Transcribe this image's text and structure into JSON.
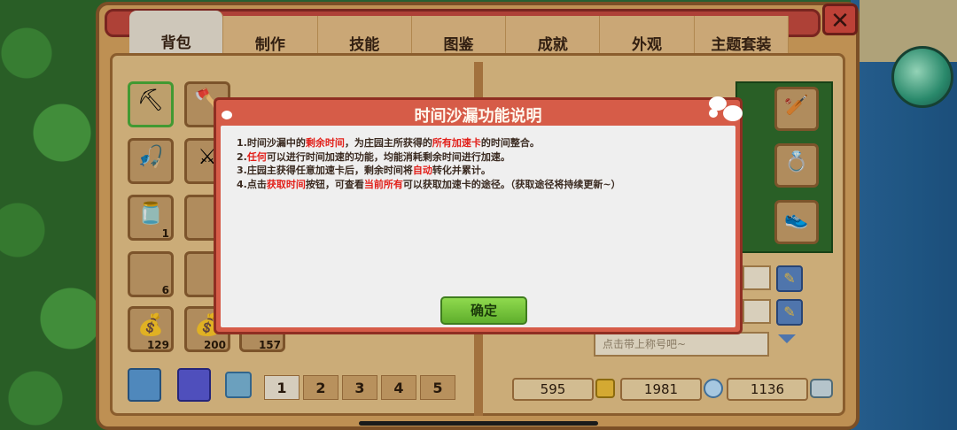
{
  "tabs": [
    {
      "label": "背包",
      "active": true
    },
    {
      "label": "制作",
      "active": false
    },
    {
      "label": "技能",
      "active": false
    },
    {
      "label": "图鉴",
      "active": false
    },
    {
      "label": "成就",
      "active": false
    },
    {
      "label": "外观",
      "active": false
    },
    {
      "label": "主题套装",
      "active": false
    }
  ],
  "close_label": "✕",
  "inventory": {
    "counts": [
      "1",
      "6",
      "129",
      "200",
      "157"
    ]
  },
  "pagination": {
    "pages": [
      "1",
      "2",
      "3",
      "4",
      "5"
    ],
    "current": "1"
  },
  "currencies": {
    "gold": "595",
    "coin": "1981",
    "gem": "1136"
  },
  "title_placeholder": "点击带上称号吧~",
  "dialog": {
    "title": "时间沙漏功能说明",
    "rules": [
      {
        "parts": [
          {
            "t": "1.时间沙漏中的",
            "hl": false
          },
          {
            "t": "剩余时间",
            "hl": true
          },
          {
            "t": "，为庄园主所获得的",
            "hl": false
          },
          {
            "t": "所有加速卡",
            "hl": true
          },
          {
            "t": "的时间整合。",
            "hl": false
          }
        ]
      },
      {
        "parts": [
          {
            "t": "2.",
            "hl": false
          },
          {
            "t": "任何",
            "hl": true
          },
          {
            "t": "可以进行时间加速的功能，均能消耗剩余时间进行加速。",
            "hl": false
          }
        ]
      },
      {
        "parts": [
          {
            "t": "3.庄园主获得任意加速卡后，剩余时间将",
            "hl": false
          },
          {
            "t": "自动",
            "hl": true
          },
          {
            "t": "转化并累计。",
            "hl": false
          }
        ]
      },
      {
        "parts": [
          {
            "t": "4.点击",
            "hl": false
          },
          {
            "t": "获取时间",
            "hl": true
          },
          {
            "t": "按钮，可查看",
            "hl": false
          },
          {
            "t": "当前所有",
            "hl": true
          },
          {
            "t": "可以获取加速卡的途径。（获取途径将持续更新~）",
            "hl": false
          }
        ]
      }
    ],
    "confirm_label": "确定"
  },
  "colors": {
    "highlight": "#e2201a",
    "dialog_header": "#d65c48",
    "confirm_green": "#6fbf36",
    "panel": "#d9a45f"
  },
  "icons": [
    "pickaxe-icon",
    "axe-icon",
    "fishing-rod-icon",
    "sword-icon",
    "bottle-icon",
    "bag-icon",
    "bat-icon",
    "ring-icon",
    "shoe-icon",
    "pencil-icon",
    "coin-icon",
    "gem-icon"
  ]
}
